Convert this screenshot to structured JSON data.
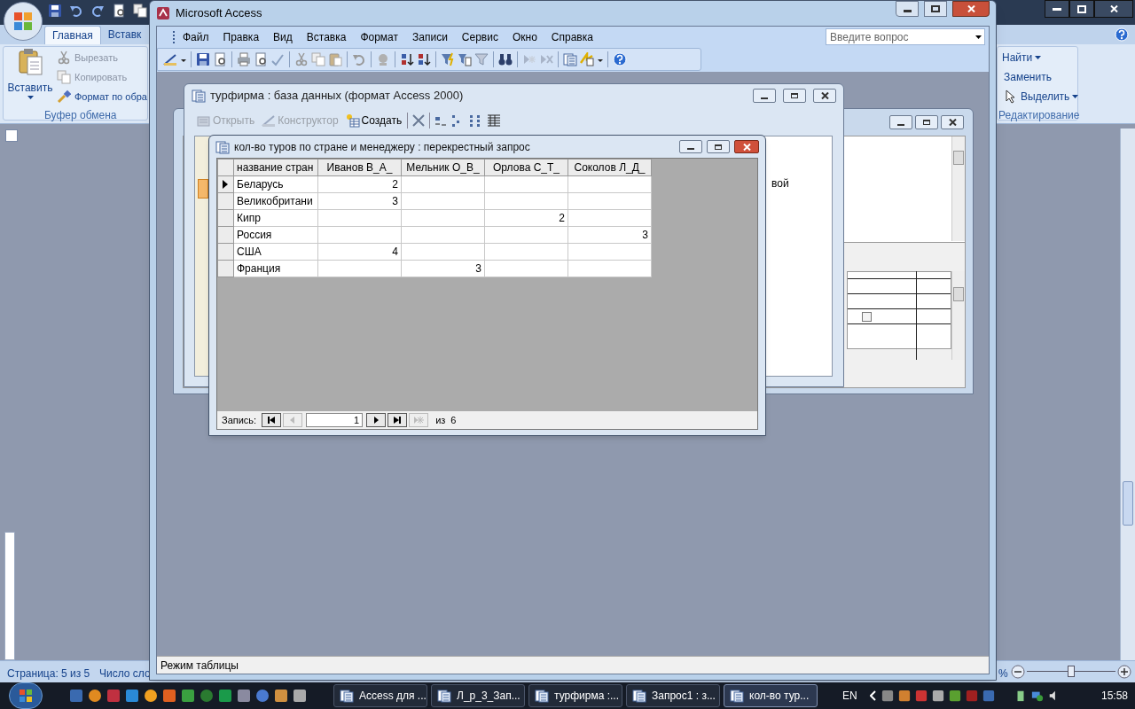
{
  "word": {
    "tabs": [
      {
        "label": "Главная",
        "selected": true
      },
      {
        "label": "Вставк",
        "selected": false
      }
    ],
    "clipboard": {
      "paste": "Вставить",
      "cut": "Вырезать",
      "copy": "Копировать",
      "format_painter": "Формат по обра",
      "group": "Буфер обмена"
    },
    "editing": {
      "find": "Найти",
      "replace": "Заменить",
      "select": "Выделить",
      "group": "Редактирование"
    },
    "status_bar": {
      "page": "Страница: 5 из 5",
      "words": "Число сло",
      "zoom": "%",
      "zoom_slider": {
        "level": 0.5
      }
    }
  },
  "back_window": {
    "checkbox_checked": false
  },
  "access": {
    "title": "Microsoft Access",
    "menu": [
      "Файл",
      "Правка",
      "Вид",
      "Вставка",
      "Формат",
      "Записи",
      "Сервис",
      "Окно",
      "Справка"
    ],
    "help_placeholder": "Введите вопрос",
    "status": "Режим таблицы"
  },
  "db_window": {
    "title": "турфирма : база данных (формат Access 2000)",
    "toolbar": [
      {
        "label": "Открыть",
        "disabled": true
      },
      {
        "label": "Конструктор",
        "disabled": true
      },
      {
        "label": "Создать",
        "disabled": false
      }
    ],
    "partial_text": "вой"
  },
  "query_window": {
    "title": "кол-во туров по стране и менеджеру : перекрестный запрос",
    "columns": [
      "название стран",
      "Иванов В_А_",
      "Мельник О_В_",
      "Орлова С_Т_",
      "Соколов Л_Д_"
    ],
    "rows": [
      {
        "current": true,
        "cells": [
          "Беларусь",
          "2",
          "",
          "",
          ""
        ]
      },
      {
        "current": false,
        "cells": [
          "Великобритани",
          "3",
          "",
          "",
          ""
        ]
      },
      {
        "current": false,
        "cells": [
          "Кипр",
          "",
          "",
          "2",
          ""
        ]
      },
      {
        "current": false,
        "cells": [
          "Россия",
          "",
          "",
          "",
          "3"
        ]
      },
      {
        "current": false,
        "cells": [
          "США",
          "4",
          "",
          "",
          ""
        ]
      },
      {
        "current": false,
        "cells": [
          "Франция",
          "",
          "3",
          "",
          ""
        ]
      }
    ],
    "navigation": {
      "label": "Запись:",
      "record": "1",
      "of": "из",
      "total": "6"
    }
  },
  "taskbar": {
    "tasks": [
      {
        "label": "Access для ...",
        "selected": false
      },
      {
        "label": "Л_р_3_Зап...",
        "selected": false
      },
      {
        "label": "турфирма :...",
        "selected": false
      },
      {
        "label": "Запрос1 : з...",
        "selected": false
      },
      {
        "label": "кол-во тур...",
        "selected": true
      }
    ],
    "language": "EN",
    "clock": "15:58"
  }
}
